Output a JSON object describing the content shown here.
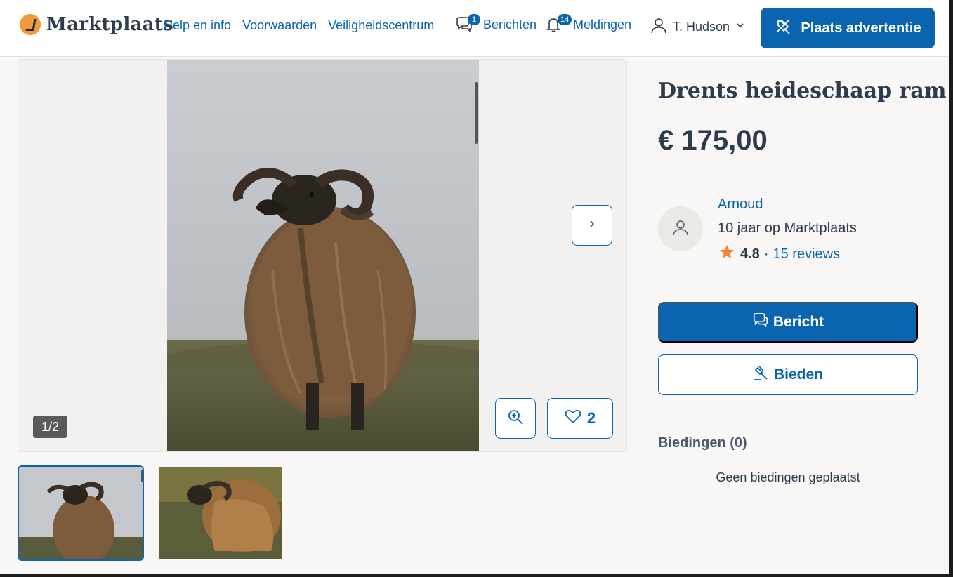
{
  "header": {
    "brand": "Marktplaats",
    "links": [
      "Help en info",
      "Voorwaarden",
      "Veiligheidscentrum"
    ],
    "messages": {
      "label": "Berichten",
      "badge": "1",
      "icon": "chat-icon"
    },
    "notifications": {
      "label": "Meldingen",
      "badge": "14",
      "icon": "bell-icon"
    },
    "user": {
      "name": "T. Hudson",
      "icon": "user-icon"
    },
    "post_ad_label": "Plaats advertentie"
  },
  "gallery": {
    "counter": "1/2",
    "favorites_count": "2"
  },
  "listing": {
    "title": "Drents heideschaap ram",
    "price": "€ 175,00"
  },
  "seller": {
    "name": "Arnoud",
    "since": "10 jaar op Marktplaats",
    "rating": "4.8",
    "separator": "·",
    "reviews": "15 reviews"
  },
  "actions": {
    "message_label": "Bericht",
    "bid_label": "Bieden"
  },
  "bids": {
    "title": "Biedingen (0)",
    "empty": "Geen biedingen geplaatst"
  },
  "colors": {
    "accent": "#0b64b0",
    "brand_orange": "#f09a39",
    "star": "#f0843a"
  }
}
